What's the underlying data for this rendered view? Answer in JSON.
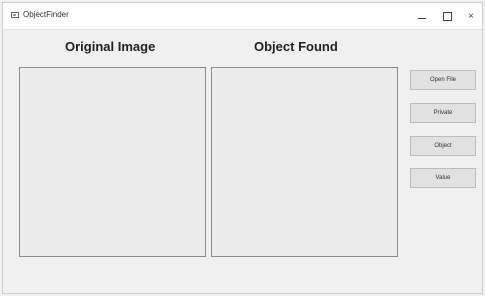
{
  "window": {
    "title": "ObjectFinder",
    "controls": {
      "minimize": "–",
      "close": "×"
    }
  },
  "headings": {
    "original": "Original Image",
    "found": "Object Found"
  },
  "buttons": [
    {
      "label": "Open File"
    },
    {
      "label": "Private"
    },
    {
      "label": "Object"
    },
    {
      "label": "Value"
    }
  ]
}
